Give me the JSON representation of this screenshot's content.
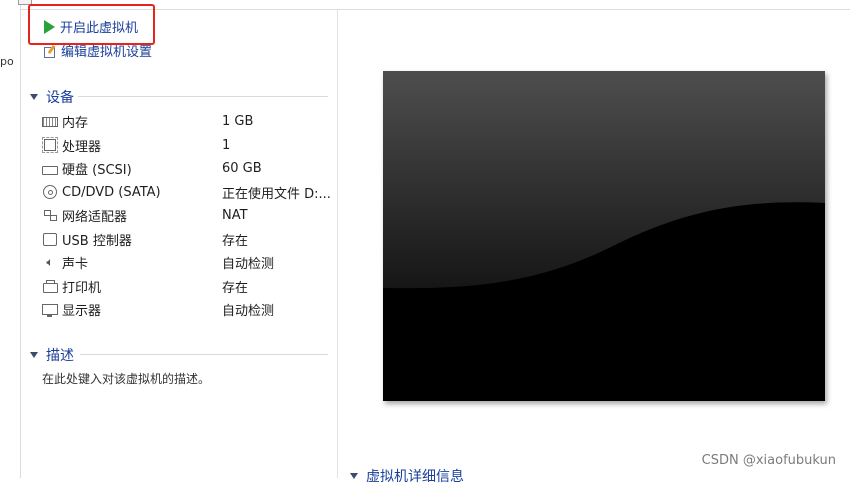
{
  "left_strip": {
    "cut_text": "po"
  },
  "actions": {
    "power_on": "开启此虚拟机",
    "edit_settings": "编辑虚拟机设置"
  },
  "devices_section": {
    "title": "设备",
    "items": [
      {
        "icon": "memory-icon",
        "name": "内存",
        "value": "1 GB"
      },
      {
        "icon": "processor-icon",
        "name": "处理器",
        "value": "1"
      },
      {
        "icon": "hard-disk-icon",
        "name": "硬盘 (SCSI)",
        "value": "60 GB"
      },
      {
        "icon": "cd-dvd-icon",
        "name": "CD/DVD (SATA)",
        "value": "正在使用文件 D:..."
      },
      {
        "icon": "network-adapter-icon",
        "name": "网络适配器",
        "value": "NAT"
      },
      {
        "icon": "usb-controller-icon",
        "name": "USB 控制器",
        "value": "存在"
      },
      {
        "icon": "sound-card-icon",
        "name": "声卡",
        "value": "自动检测"
      },
      {
        "icon": "printer-icon",
        "name": "打印机",
        "value": "存在"
      },
      {
        "icon": "display-icon",
        "name": "显示器",
        "value": "自动检测"
      }
    ]
  },
  "description_section": {
    "title": "描述",
    "placeholder": "在此处键入对该虚拟机的描述。"
  },
  "details_section": {
    "title": "虚拟机详细信息"
  },
  "watermark": "CSDN @xiaofubukun",
  "colors": {
    "link_blue": "#1a3e9a",
    "play_green": "#27a33a",
    "highlight_red": "#e8231c",
    "screen_black": "#000000"
  }
}
